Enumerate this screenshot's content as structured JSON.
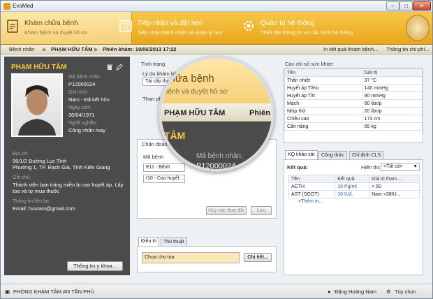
{
  "window": {
    "title": "EvoMed",
    "min": "–",
    "max": "□",
    "close": "✕"
  },
  "ribbon": {
    "tabs": [
      {
        "title": "Khám chữa bệnh",
        "subtitle": "Khám bệnh và duyệt hồ sơ"
      },
      {
        "title": "Tiếp nhận và đặt hẹn",
        "subtitle": "Tiếp nhận bệnh nhân và quản lý hẹn"
      },
      {
        "title": "Quản trị hệ thống",
        "subtitle": "Thiết đặt thông tin và cấu hình hệ thống"
      }
    ],
    "logo": "EVO"
  },
  "breadcrumb": {
    "root": "Bệnh nhân",
    "patient": "PHẠM HỮU TÂM",
    "session": "Phiên khám: 19/06/2013 17:22",
    "print": "In kết quả khám bệnh...",
    "info": "Thông tin chi phí..."
  },
  "patient": {
    "name": "PHẠM HỮU TÂM",
    "id_label": "Mã bệnh nhân:",
    "id": "P12000024",
    "gender_label": "Giới tính:",
    "gender": "Nam - Đã kết hôn",
    "dob_label": "Ngày sinh:",
    "dob": "30/04/1971",
    "job_label": "Nghề nghiệp:",
    "job": "Công nhân may",
    "addr_label": "Địa chỉ:",
    "addr1": "99/1/2 Đường Lục Tỉnh",
    "addr2": "Phường 1, TP. Rạch Giá, Tỉnh Kiên Giang",
    "note_label": "Ghi chú:",
    "note1": "Thành viên ban tráng miền bị cao huyết áp. Lấy",
    "note2": "toa và tự mua thuốc",
    "contact_label": "Thông tin liên lạc:",
    "email": "Email: huutam@gmail.com",
    "info_button": "Thông tin y khoa..."
  },
  "exam": {
    "condition_label": "Tình trạng",
    "reason_label": "Lý do khám bệnh",
    "reason": "Tái cấp thuốc",
    "symptom_label": "Than phiền:",
    "diag_label": "Chẩn đoán",
    "diag_sub": "Mã bệnh",
    "diag_rows": [
      "E11 - Bệnh",
      "I10 - Cao huyết..."
    ],
    "cancel": "Hủy các thay đổi",
    "save": "Lưu",
    "tabs": [
      "Điều trị",
      "Thủ thuật"
    ],
    "treatment": "Chưa cho toa",
    "detail": "Chi tiết..."
  },
  "vitals": {
    "title": "Các chỉ số sức khỏe:",
    "headers": [
      "Tên",
      "Giá trị"
    ],
    "rows": [
      [
        "Thân nhiệt",
        "37 °C"
      ],
      [
        "Huyết áp T/thu",
        "140 mmHg"
      ],
      [
        "Huyết áp T/tr",
        "90 mmHg"
      ],
      [
        "Mạch",
        "80 lần/p"
      ],
      [
        "Nhịp thở",
        "20 lần/p"
      ],
      [
        "Chiều cao",
        "173 cm"
      ],
      [
        "Cân nặng",
        "65 kg"
      ]
    ]
  },
  "lab": {
    "tabs": [
      "KQ khảo sát",
      "Công thức",
      "Chỉ định CLS"
    ],
    "result_label": "Kết quả:",
    "show_label": "Hiển thị:",
    "show_value": "<Tất cả>",
    "headers": [
      "Tên",
      "Kết quả",
      "Giá trị tham ..."
    ],
    "rows": [
      [
        "ACTH",
        "10 Pg/ml",
        "< 50"
      ],
      [
        "AST (SGOT)",
        "10 IU/L",
        "Nam <38IU..."
      ]
    ],
    "more": "<Thêm m..."
  },
  "magnifier": {
    "title": "chữa bệnh",
    "subtitle": "bệnh và duyệt hồ sơ",
    "patient": "PHẠM HỮU TÂM",
    "session": "Phiên khám",
    "name": "TÂM",
    "id_label": "Mã bệnh nhân:",
    "id": "P12000024"
  },
  "status": {
    "clinic": "PHÒNG KHÁM TÂM AN TẤN PHÚ",
    "user": "Đặng Hoàng Nam",
    "options": "Tùy chọn"
  }
}
